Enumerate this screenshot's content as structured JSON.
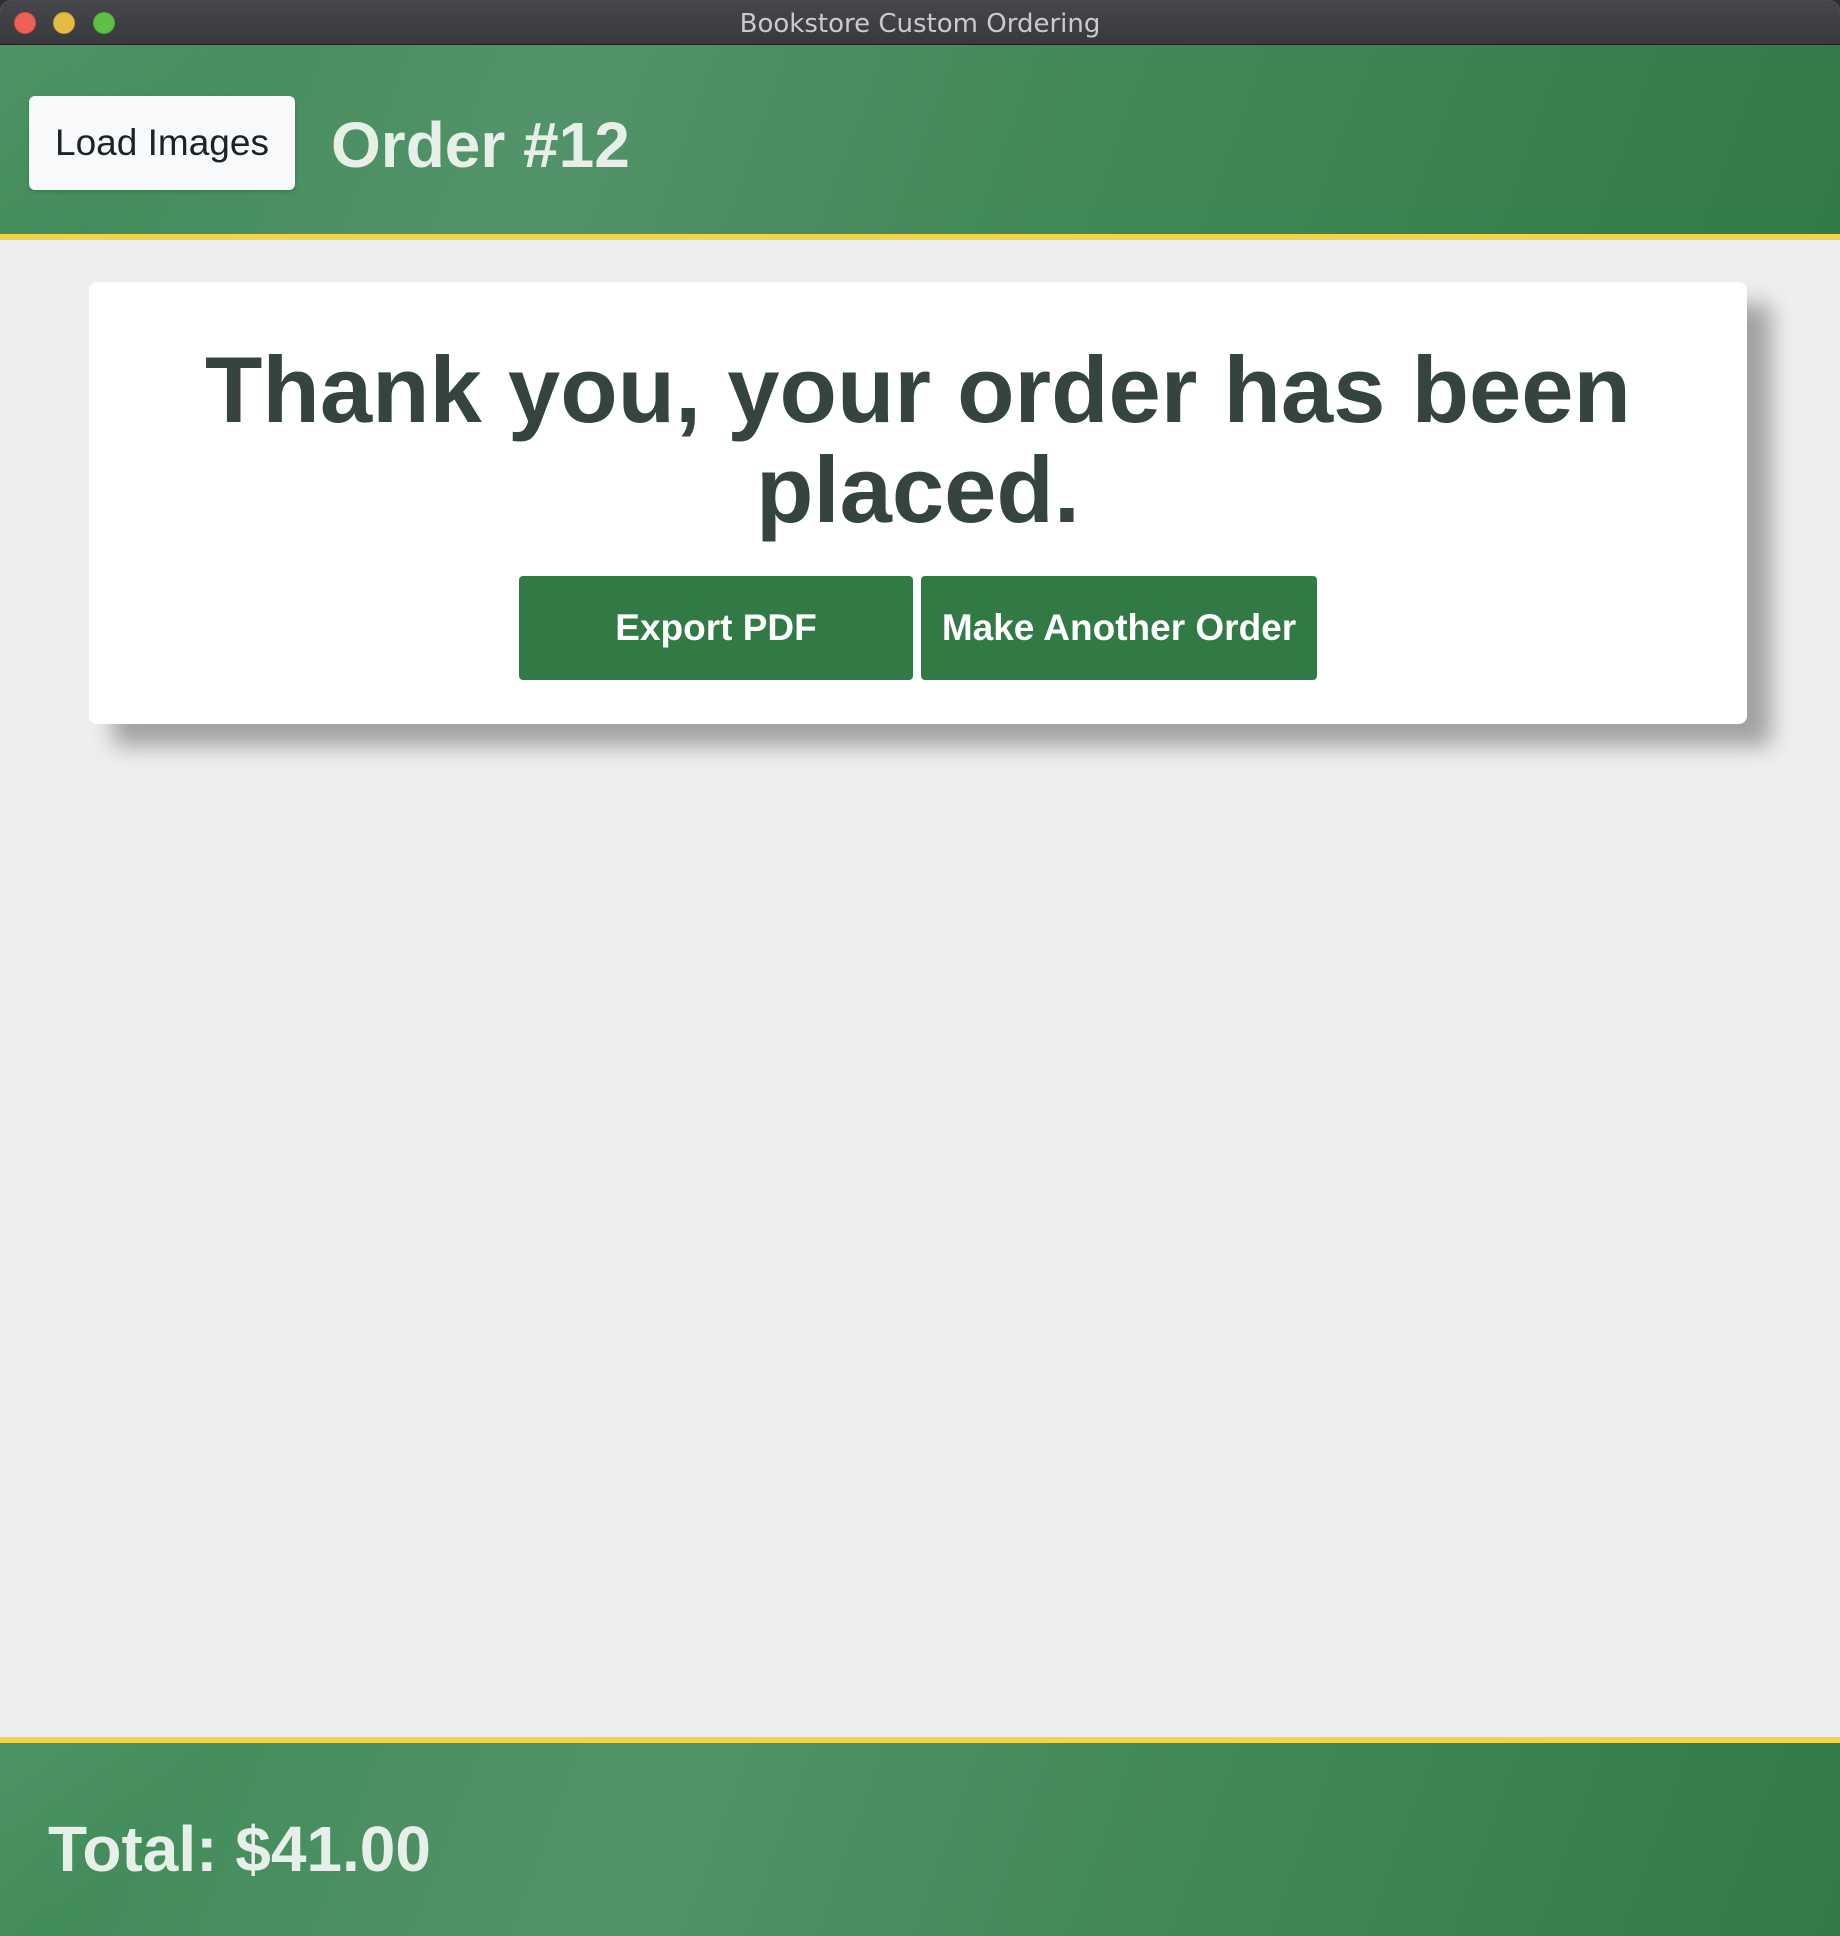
{
  "window": {
    "title": "Bookstore Custom Ordering"
  },
  "header": {
    "load_images_label": "Load Images",
    "order_title": "Order #12"
  },
  "confirmation": {
    "message": "Thank you, your order has been placed.",
    "export_pdf_label": "Export PDF",
    "make_another_order_label": "Make Another Order"
  },
  "footer": {
    "total_text": "Total: $41.00"
  },
  "colors": {
    "primary_green": "#317a46",
    "accent_yellow": "#f1d44a",
    "background": "#edeef0",
    "heading_text": "#354441"
  }
}
